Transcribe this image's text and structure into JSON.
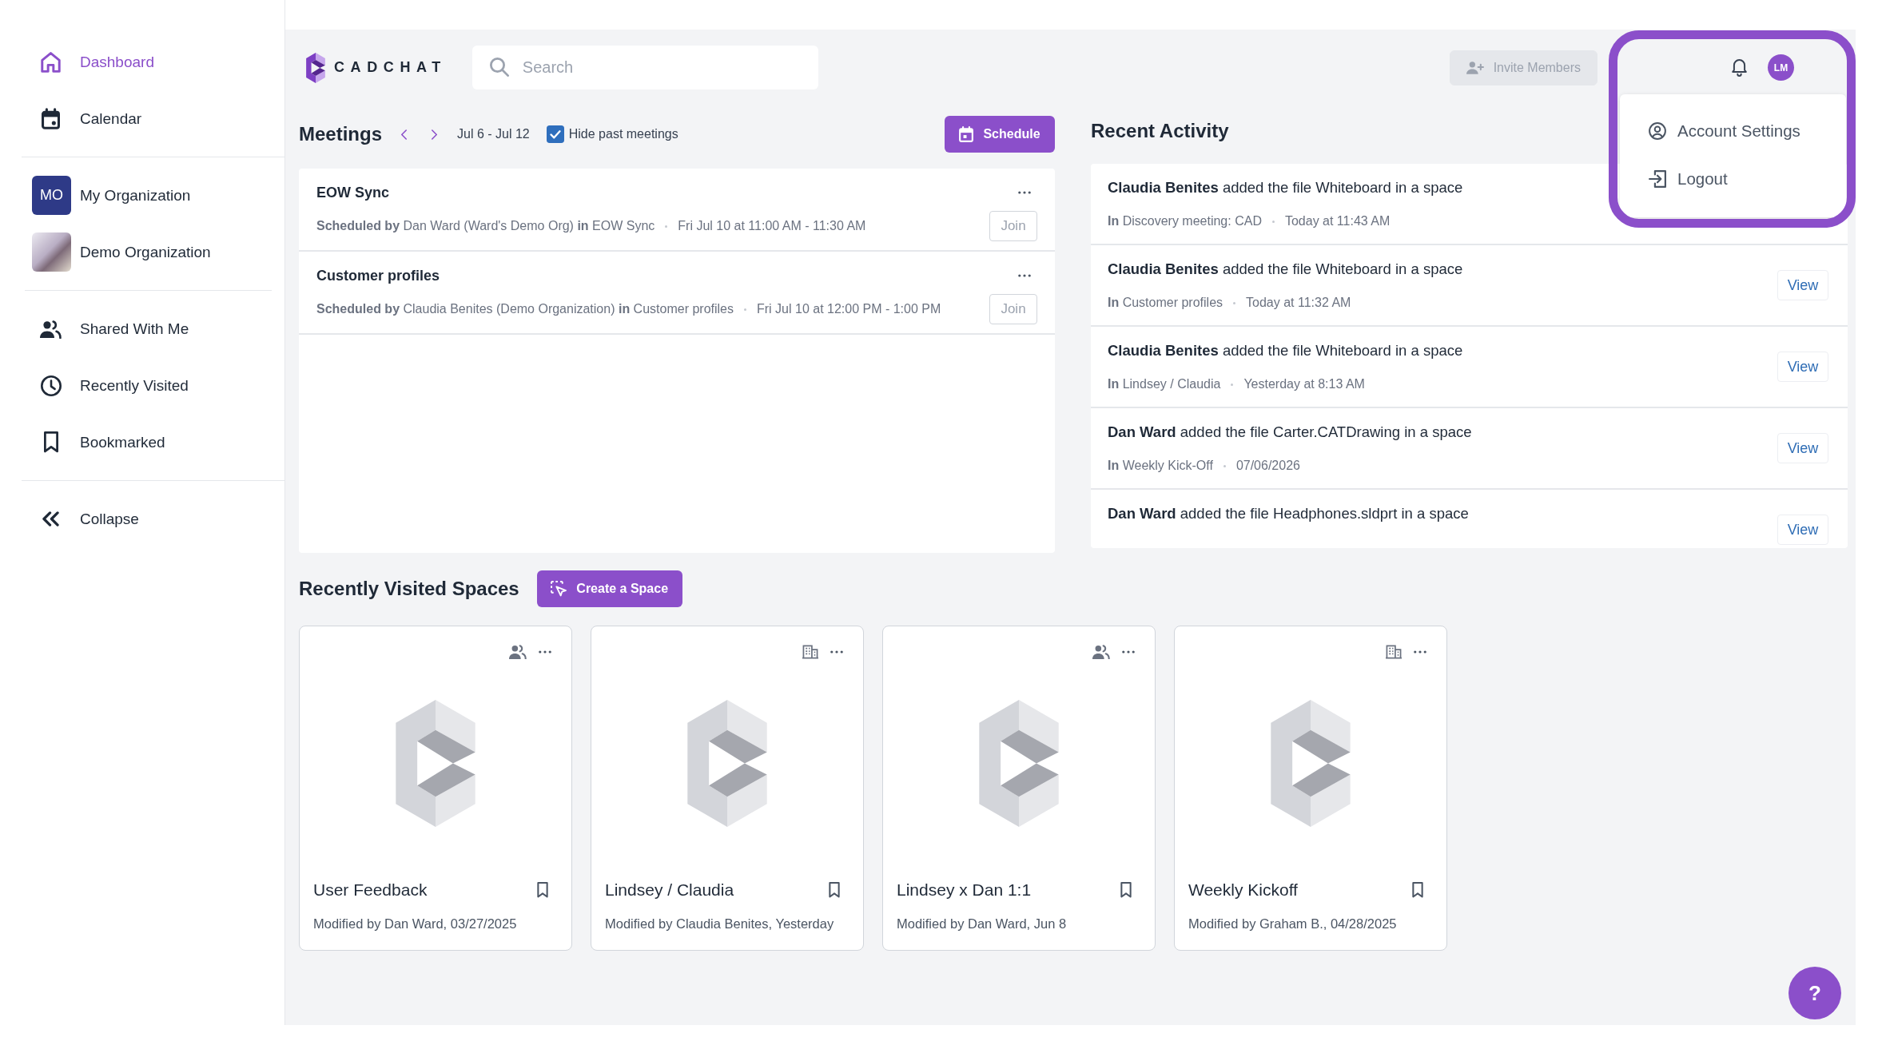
{
  "sidebar": {
    "nav_items": [
      {
        "label": "Dashboard",
        "selected": true
      },
      {
        "label": "Calendar",
        "selected": false
      }
    ],
    "organizations": [
      {
        "name": "My Organization",
        "kind": "initials",
        "badge": "MO",
        "selected": false
      },
      {
        "name": "Demo Organization",
        "kind": "image",
        "selected": false
      }
    ],
    "library_items": [
      {
        "label": "Shared With Me",
        "selected": false
      },
      {
        "label": "Recently Visited",
        "selected": false
      },
      {
        "label": "Bookmarked",
        "selected": false
      }
    ],
    "collapse": {
      "label": "Collapse"
    }
  },
  "topbar": {
    "logo": "CADCHAT",
    "search": {
      "placeholder": "Search"
    },
    "invite_button": {
      "label": "Invite Members",
      "disabled": true
    },
    "avatar": {
      "initials": "LM"
    }
  },
  "account_menu": {
    "items": [
      {
        "label": "Account Settings"
      },
      {
        "label": "Logout"
      }
    ]
  },
  "meetings": {
    "title": "Meetings",
    "date_range": "Jul 6 - Jul 12",
    "hide_past": {
      "label": "Hide past meetings",
      "checked": true
    },
    "schedule_button": "Schedule",
    "items": [
      {
        "title": "EOW Sync",
        "details": "**Scheduled by** Dan Ward (Ward's Demo Org) **in** EOW Sync",
        "time": "Fri Jul 10 at 11:00 AM - 11:30 AM",
        "join": {
          "label": "Join",
          "disabled": true
        }
      },
      {
        "title": "Customer profiles",
        "details": "**Scheduled by** Claudia Benites (Demo Organization) **in** Customer profiles",
        "time": "Fri Jul 10 at 12:00 PM - 1:00 PM",
        "join": {
          "label": "Join",
          "disabled": true
        }
      }
    ]
  },
  "recent_activity": {
    "title": "Recent Activity",
    "items": [
      {
        "text": "**Claudia Benites** added the file Whiteboard in a space",
        "location": "**In** Discovery meeting: CAD",
        "time": "Today at 11:43 AM"
      },
      {
        "text": "**Claudia Benites** added the file Whiteboard in a space",
        "location": "**In** Customer profiles",
        "time": "Today at 11:32 AM",
        "action": "View"
      },
      {
        "text": "**Claudia Benites** added the file Whiteboard in a space",
        "location": "**In** Lindsey / Claudia",
        "time": "Yesterday at 8:13 AM",
        "action": "View"
      },
      {
        "text": "**Dan Ward** added the file Carter.CATDrawing in a space",
        "location": "**In** Weekly Kick-Off",
        "time": "07/06/2026",
        "action": "View"
      },
      {
        "text": "**Dan Ward** added the file Headphones.sldprt in a space",
        "action": "View"
      }
    ]
  },
  "spaces": {
    "title": "Recently Visited Spaces",
    "create_button": "Create a Space",
    "cards": [
      {
        "name": "User Feedback",
        "kind": "shared",
        "modified": "Modified by Dan Ward, 03/27/2025",
        "bookmarked": false
      },
      {
        "name": "Lindsey / Claudia",
        "kind": "organization",
        "modified": "Modified by Claudia Benites, Yesterday",
        "bookmarked": false
      },
      {
        "name": "Lindsey x Dan 1:1",
        "kind": "shared",
        "modified": "Modified by Dan Ward, Jun 8",
        "bookmarked": false
      },
      {
        "name": "Weekly Kickoff",
        "kind": "organization",
        "modified": "Modified by Graham B., 04/28/2025",
        "bookmarked": false
      }
    ]
  },
  "help_button": {
    "label": "?"
  }
}
